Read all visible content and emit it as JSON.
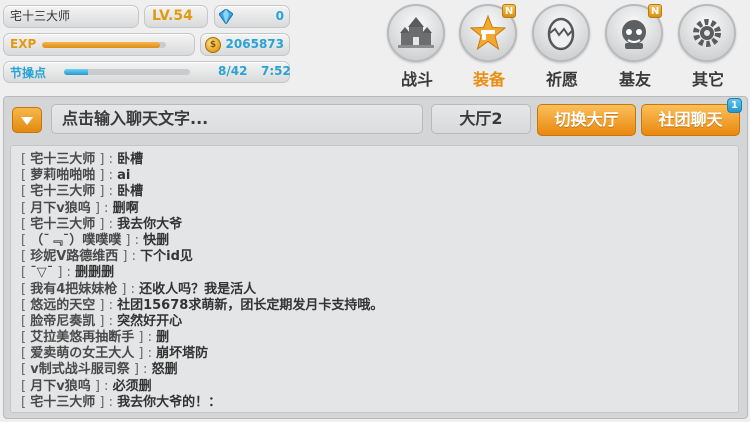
{
  "player": {
    "name": "宅十三大师",
    "level": "LV.54",
    "gems": "0",
    "exp_label": "EXP",
    "exp_progress": 0.95,
    "coins": "2065873",
    "stamina_label": "节操点",
    "stamina_count": "8/42",
    "stamina_progress": 0.19,
    "stamina_timer": "7:52"
  },
  "nav": [
    {
      "label": "战斗",
      "icon": "castle-icon",
      "badge": ""
    },
    {
      "label": "装备",
      "icon": "star-gun-icon",
      "badge": "N"
    },
    {
      "label": "祈愿",
      "icon": "egg-icon",
      "badge": ""
    },
    {
      "label": "基友",
      "icon": "friend-icon",
      "badge": "N"
    },
    {
      "label": "其它",
      "icon": "gear-icon",
      "badge": ""
    }
  ],
  "chat": {
    "input_placeholder": "点击输入聊天文字...",
    "channel_label": "大厅2",
    "switch_button": "切换大厅",
    "guild_button": "社团聊天",
    "guild_badge": "1",
    "messages": [
      {
        "name": "宅十三大师",
        "text": "卧槽"
      },
      {
        "name": "萝莉啪啪啪",
        "text": "ai"
      },
      {
        "name": "宅十三大师",
        "text": "卧槽"
      },
      {
        "name": "月下v狼呜",
        "text": "删啊"
      },
      {
        "name": "宅十三大师",
        "text": "我去你大爷"
      },
      {
        "name": "（¯﹃¯）噗噗噗",
        "text": "快删"
      },
      {
        "name": "珍妮V路德维西",
        "text": "下个id见"
      },
      {
        "name": "¯▽¯",
        "text": "删删删"
      },
      {
        "name": "我有4把妹妹枪",
        "text": "还收人吗？我是活人"
      },
      {
        "name": "悠远的天空",
        "text": "社团15678求萌新，团长定期发月卡支持哦。"
      },
      {
        "name": "脸帝尼奏凯",
        "text": "突然好开心"
      },
      {
        "name": "艾拉美悠再抽断手",
        "text": "删"
      },
      {
        "name": "爱卖萌の女王大人",
        "text": "崩坏塔防"
      },
      {
        "name": "v制式战斗服司祭",
        "text": "怒删"
      },
      {
        "name": "月下v狼呜",
        "text": "必须删"
      },
      {
        "name": "宅十三大师",
        "text": "我去你大爷的！："
      }
    ]
  },
  "colors": {
    "accent_orange": "#e9880f",
    "accent_blue": "#2aa2d6",
    "level_gold": "#e29a12"
  }
}
